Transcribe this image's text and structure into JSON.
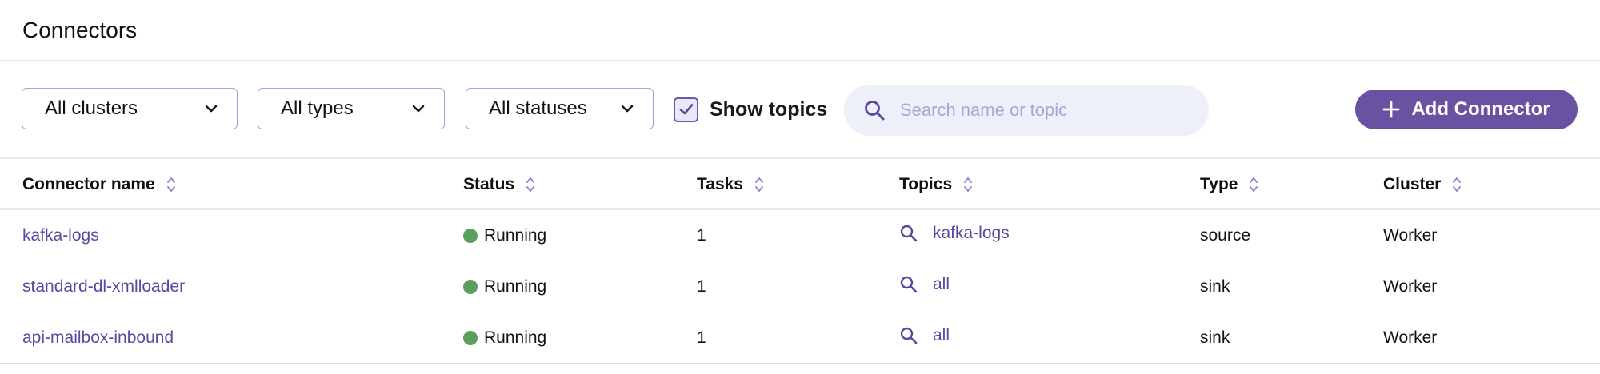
{
  "header": {
    "title": "Connectors"
  },
  "filters": {
    "clusters": {
      "selected": "All clusters"
    },
    "types": {
      "selected": "All types"
    },
    "statuses": {
      "selected": "All statuses"
    },
    "show_topics": {
      "label": "Show topics",
      "checked": true
    }
  },
  "search": {
    "placeholder": "Search name or topic",
    "value": ""
  },
  "add_button": {
    "label": "Add Connector"
  },
  "table": {
    "columns": [
      "Connector name",
      "Status",
      "Tasks",
      "Topics",
      "Type",
      "Cluster"
    ],
    "rows": [
      {
        "name": "kafka-logs",
        "status": "Running",
        "tasks": "1",
        "topics": "kafka-logs",
        "type": "source",
        "cluster": "Worker"
      },
      {
        "name": "standard-dl-xmlloader",
        "status": "Running",
        "tasks": "1",
        "topics": "all",
        "type": "sink",
        "cluster": "Worker"
      },
      {
        "name": "api-mailbox-inbound",
        "status": "Running",
        "tasks": "1",
        "topics": "all",
        "type": "sink",
        "cluster": "Worker"
      }
    ]
  },
  "colors": {
    "accent": "#6a52a3",
    "link": "#5a48a0",
    "status_running": "#5b9f5f",
    "search_bg": "#edf0f8"
  },
  "icons": {
    "dropdown": "chevron-down-icon",
    "checkbox": "check-icon",
    "search": "search-icon",
    "add": "plus-icon",
    "sort": "sort-icon",
    "status": "status-dot-icon",
    "topic": "search-icon"
  }
}
